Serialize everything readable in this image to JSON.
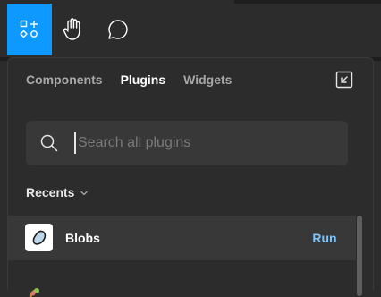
{
  "toolbar": {
    "tools": [
      {
        "icon": "resources-icon",
        "active": true
      },
      {
        "icon": "hand-icon",
        "active": false
      },
      {
        "icon": "comment-icon",
        "active": false
      }
    ],
    "accent_color": "#0d99ff"
  },
  "panel": {
    "tabs": [
      {
        "label": "Components",
        "active": false
      },
      {
        "label": "Plugins",
        "active": true
      },
      {
        "label": "Widgets",
        "active": false
      }
    ],
    "expand_icon": "expand-icon",
    "search": {
      "placeholder": "Search all plugins",
      "value": ""
    },
    "section": {
      "label": "Recents"
    },
    "plugins": [
      {
        "name": "Blobs",
        "action_label": "Run",
        "icon": "blob-icon"
      }
    ]
  },
  "colors": {
    "background": "#2c2c2c",
    "row_highlight": "#383838",
    "run_text": "#7cc4fa"
  }
}
